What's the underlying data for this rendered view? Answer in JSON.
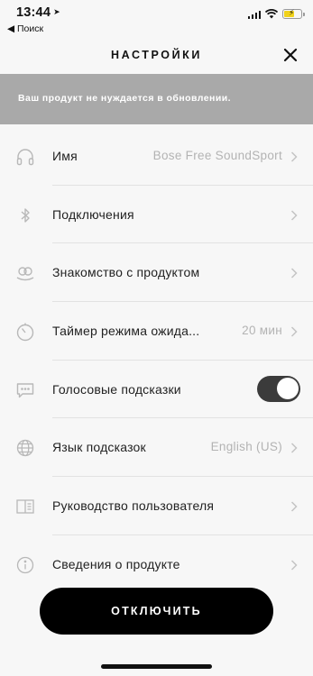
{
  "status_bar": {
    "time": "13:44",
    "back_app": "◀ Поиск"
  },
  "header": {
    "title": "НАСТРОЙКИ",
    "close_icon": "close-icon"
  },
  "banner": {
    "text": "Ваш продукт не нуждается в обновлении."
  },
  "settings": {
    "items": [
      {
        "icon": "headphones-icon",
        "label": "Имя",
        "value": "Bose Free SoundSport"
      },
      {
        "icon": "bluetooth-icon",
        "label": "Подключения",
        "value": ""
      },
      {
        "icon": "earbuds-icon",
        "label": "Знакомство с продуктом",
        "value": ""
      },
      {
        "icon": "timer-icon",
        "label": "Таймер режима ожида...",
        "value": "20 мин"
      },
      {
        "icon": "speech-bubble-icon",
        "label": "Голосовые подсказки",
        "toggle_on": true
      },
      {
        "icon": "globe-icon",
        "label": "Язык подсказок",
        "value": "English (US)"
      },
      {
        "icon": "manual-icon",
        "label": "Руководство пользователя",
        "value": ""
      },
      {
        "icon": "info-icon",
        "label": "Сведения о продукте",
        "value": ""
      }
    ]
  },
  "footer": {
    "disconnect_label": "ОТКЛЮЧИТЬ"
  },
  "colors": {
    "banner_bg": "#a9a9a9",
    "toggle_on": "#3b3b3b",
    "button_bg": "#000000",
    "battery": "#f1d21a"
  }
}
